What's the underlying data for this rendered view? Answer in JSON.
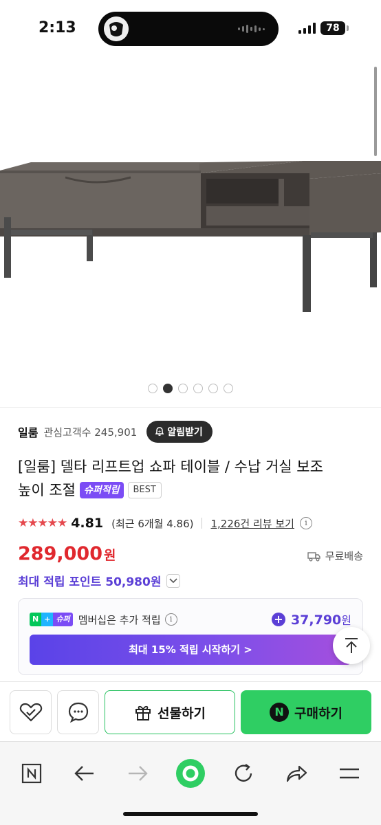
{
  "status_bar": {
    "time": "2:13",
    "battery": "78"
  },
  "store": {
    "name": "일룸",
    "interest_label": "관심고객수",
    "interest_count": "245,901",
    "alert_label": "알림받기"
  },
  "product": {
    "title_line1": "[일룸] 델타 리프트업 쇼파 테이블 / 수납 거실 보조",
    "title_line2": "높이 조절",
    "badge_super": "슈퍼적립",
    "badge_best": "BEST",
    "image_count": 6,
    "active_image_index": 1
  },
  "rating": {
    "stars": "★★★★★",
    "value": "4.81",
    "recent": "(최근 6개월 4.86)",
    "review_link": "1,226건 리뷰 보기",
    "info": "i"
  },
  "price": {
    "value": "289,000",
    "unit": "원",
    "shipping": "무료배송"
  },
  "points": {
    "label": "최대 적립 포인트 50,980원"
  },
  "membership": {
    "n_label": "N",
    "plus_label": "+",
    "super_label": "슈퍼",
    "text": "멤버십은 추가 적립",
    "info": "i",
    "bonus_sign": "+",
    "bonus_value": "37,790",
    "bonus_unit": "원",
    "cta": "최대 15% 적립 시작하기 >"
  },
  "actions": {
    "gift_label": "선물하기",
    "buy_label": "구매하기",
    "buy_icon_text": "N"
  },
  "colors": {
    "price_red": "#e0282e",
    "points_purple": "#5b3fd6",
    "buy_green": "#2fce63",
    "star_red": "#e5484d"
  },
  "icons": {
    "wishlist": "heart-check-icon",
    "talk": "chat-bubble-icon",
    "gift": "gift-icon",
    "truck": "truck-icon",
    "bell": "bell-icon",
    "scroll_top": "arrow-up-icon",
    "browser": [
      "n-home-icon",
      "back-arrow-icon",
      "forward-arrow-icon",
      "green-dot-icon",
      "refresh-icon",
      "share-icon",
      "menu-icon"
    ]
  }
}
